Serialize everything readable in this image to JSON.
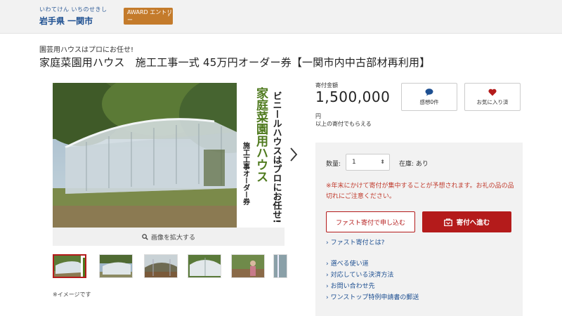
{
  "header": {
    "region_ruby": "いわてけん いちのせきし",
    "region_name": "岩手県 一関市",
    "award_label": "AWARD エントリー",
    "award_arrow": "›"
  },
  "product": {
    "catch": "園芸用ハウスはプロにお任せ!",
    "title": "家庭菜園用ハウス　施工工事一式 45万円オーダー券【一関市内中古部材再利用】",
    "image_caption_lines": [
      "ビニールハウスはプロにお任せ!",
      "家庭菜園用ハウス",
      "施工工事オーダー券"
    ],
    "zoom_label": "画像を拡大する",
    "image_note": "※イメージです",
    "thumb_count": 6
  },
  "donation": {
    "amount_label": "寄付金額",
    "amount": "1,500,000",
    "yen": "円",
    "yen_note": "以上の寄付でもらえる",
    "impressions_label": "感想0件",
    "favorite_label": "お気に入り済",
    "qty_label": "数量:",
    "qty_value": "1",
    "qty_caret": "⬍",
    "stock": "在庫: あり",
    "warning": "※年末にかけて寄付が集中することが予想されます。お礼の品の品切れにご注意ください。",
    "fast_button": "ファスト寄付で申し込む",
    "donate_button": "寄付へ進む"
  },
  "links": [
    "ファスト寄付とは?",
    "選べる使い道",
    "対応している決済方法",
    "お問い合わせ先",
    "ワンストップ特例申請書の郵送"
  ],
  "colors": {
    "accent": "#b41b1b",
    "link": "#1d4f91",
    "award": "#c47b2b",
    "panel_bg": "#f2f2f2"
  }
}
